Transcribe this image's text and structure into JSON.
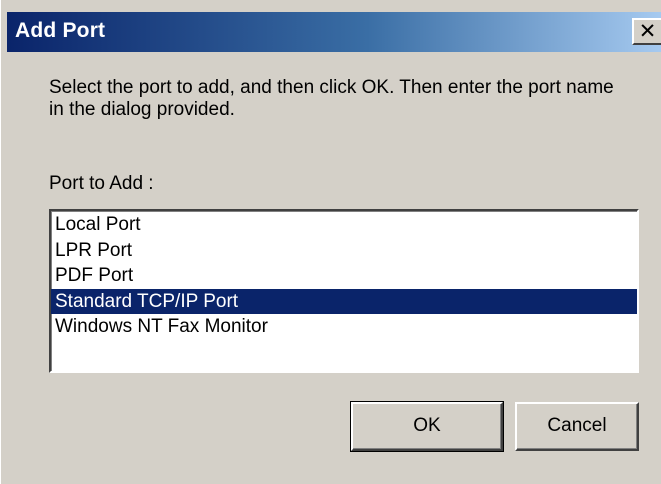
{
  "window": {
    "title": "Add Port",
    "close_glyph": "✕"
  },
  "dialog": {
    "instructions": "Select the port to add, and then click OK. Then enter the port name in the dialog provided.",
    "port_label": "Port to Add :",
    "ports": [
      {
        "label": "Local Port",
        "selected": false
      },
      {
        "label": "LPR Port",
        "selected": false
      },
      {
        "label": "PDF Port",
        "selected": false
      },
      {
        "label": "Standard TCP/IP Port",
        "selected": true
      },
      {
        "label": "Windows NT Fax Monitor",
        "selected": false
      }
    ],
    "ok_label": "OK",
    "cancel_label": "Cancel"
  },
  "colors": {
    "title_bar_start": "#0a246a",
    "title_bar_end": "#a6caf0",
    "dialog_background": "#d4d0c8",
    "selection": "#0a246a"
  },
  "icons": {
    "close": "close-icon"
  }
}
